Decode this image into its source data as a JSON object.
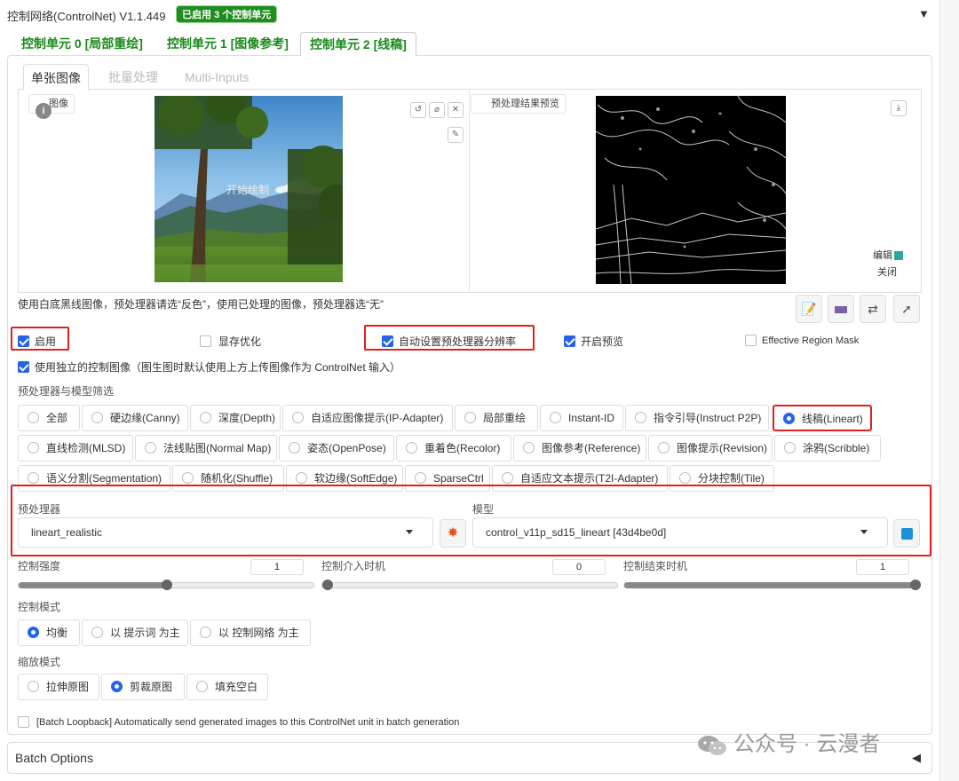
{
  "header": {
    "title": "控制网络(ControlNet) V1.1.449",
    "badge": "已启用 3 个控制单元",
    "collapse_icon": "▼"
  },
  "unit_tabs": [
    {
      "label": "控制单元 0 [局部重绘]",
      "active": false
    },
    {
      "label": "控制单元 1 [图像参考]",
      "active": false
    },
    {
      "label": "控制单元 2 [线稿]",
      "active": true
    }
  ],
  "sub_tabs": [
    {
      "label": "单张图像",
      "active": true
    },
    {
      "label": "批量处理",
      "active": false
    },
    {
      "label": "Multi-Inputs",
      "active": false
    }
  ],
  "image_input": {
    "label": "图像",
    "canvas_hint": "开始绘制",
    "buttons": [
      "↺",
      "⌀",
      "✕",
      "✎"
    ]
  },
  "preview": {
    "label": "预处理结果预览",
    "download_icon": "⤓",
    "edit_label": "编辑",
    "close_label": "关闭"
  },
  "hint": "使用白底黑线图像，预处理器请选“反色”，使用已处理的图像，预处理器选“无”",
  "tool_buttons": [
    "📝",
    "▬",
    "⇄",
    "➚"
  ],
  "options": {
    "enable": {
      "label": "启用",
      "checked": true
    },
    "low_vram": {
      "label": "显存优化",
      "checked": false
    },
    "pixel_perfect": {
      "label": "自动设置预处理器分辨率",
      "checked": true
    },
    "allow_preview": {
      "label": "开启预览",
      "checked": true
    },
    "effective_region_mask": {
      "label": "Effective Region Mask",
      "checked": false
    },
    "separate_image": {
      "label": "使用独立的控制图像（图生图时默认使用上方上传图像作为 ControlNet 输入）",
      "checked": true
    }
  },
  "filter": {
    "label": "预处理器与模型筛选",
    "rows": [
      [
        "全部",
        "硬边缘(Canny)",
        "深度(Depth)",
        "自适应图像提示(IP-Adapter)",
        "局部重绘",
        "Instant-ID",
        "指令引导(Instruct P2P)",
        "线稿(Lineart)"
      ],
      [
        "直线检测(MLSD)",
        "法线贴图(Normal Map)",
        "姿态(OpenPose)",
        "重着色(Recolor)",
        "图像参考(Reference)",
        "图像提示(Revision)",
        "涂鸦(Scribble)"
      ],
      [
        "语义分割(Segmentation)",
        "随机化(Shuffle)",
        "软边缘(SoftEdge)",
        "SparseCtrl",
        "自适应文本提示(T2I-Adapter)",
        "分块控制(Tile)"
      ]
    ],
    "selected": "线稿(Lineart)"
  },
  "preprocessor": {
    "label": "预处理器",
    "value": "lineart_realistic",
    "run_icon": "💥"
  },
  "model": {
    "label": "模型",
    "value": "control_v11p_sd15_lineart [43d4be0d]",
    "refresh_icon": "🔄"
  },
  "sliders": [
    {
      "label": "控制强度",
      "value": "1",
      "fraction": 0.5
    },
    {
      "label": "控制介入时机",
      "value": "0",
      "fraction": 0.0
    },
    {
      "label": "控制结束时机",
      "value": "1",
      "fraction": 1.0
    }
  ],
  "control_mode": {
    "label": "控制模式",
    "options": [
      "均衡",
      "以 提示词 为主",
      "以 控制网络 为主"
    ],
    "selected": "均衡"
  },
  "resize_mode": {
    "label": "缩放模式",
    "options": [
      "拉伸原图",
      "剪裁原图",
      "填充空白"
    ],
    "selected": "剪裁原图"
  },
  "batch_loopback": {
    "label": "[Batch Loopback] Automatically send generated images to this ControlNet unit in batch generation",
    "checked": false
  },
  "batch_options": {
    "label": "Batch Options",
    "icon": "◀"
  },
  "watermark": "公众号 · 云漫者"
}
